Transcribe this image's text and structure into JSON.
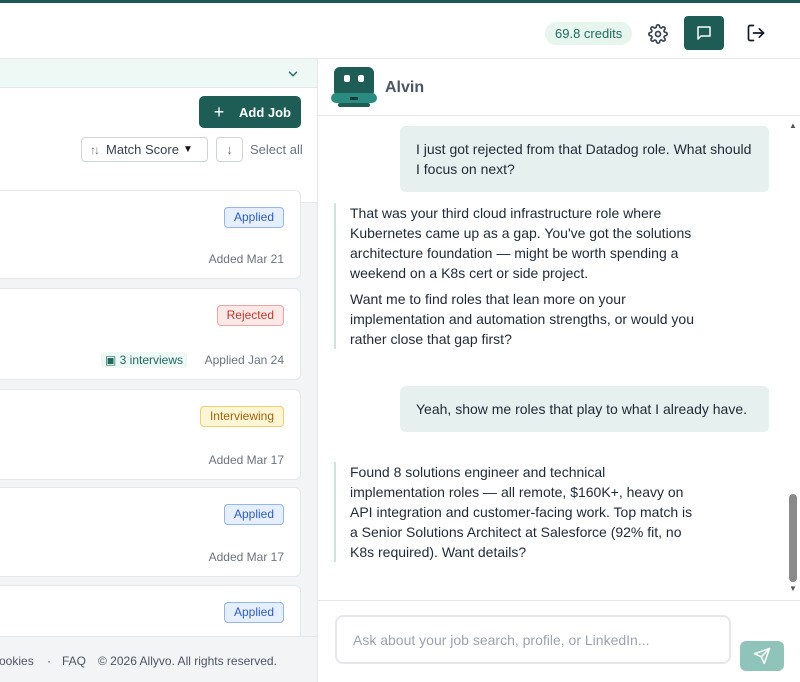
{
  "topbar": {
    "credits": "69.8 credits",
    "settings_icon": "gear-icon",
    "chat_icon": "chat-icon",
    "logout_icon": "logout-icon",
    "accent": "#1d5d56"
  },
  "jobs_panel": {
    "add_job_label": "Add Job",
    "sort_label": "Match Score",
    "select_all_label": "Select all",
    "cards": [
      {
        "status": "Applied",
        "date": "Added Mar 21"
      },
      {
        "status": "Rejected",
        "interviews": "3 interviews",
        "date": "Applied Jan 24"
      },
      {
        "status": "Interviewing",
        "date": "Added Mar 17"
      },
      {
        "status": "Applied",
        "date": "Added Mar 17"
      },
      {
        "status": "Applied"
      }
    ],
    "footer": {
      "cookies": "ookies",
      "sep": "·",
      "faq": "FAQ",
      "copyright": "© 2026 Allyvo. All rights reserved."
    }
  },
  "chat": {
    "assistant_name": "Alvin",
    "messages": [
      {
        "role": "user",
        "text": "I just got rejected from that Datadog role. What should I focus on next?"
      },
      {
        "role": "assistant",
        "paragraphs": [
          "That was your third cloud infrastructure role where Kubernetes came up as a gap. You've got the solutions architecture foundation — might be worth spending a weekend on a K8s cert or side project.",
          "Want me to find roles that lean more on your implementation and automation strengths, or would you rather close that gap first?"
        ]
      },
      {
        "role": "user",
        "text": "Yeah, show me roles that play to what I already have."
      },
      {
        "role": "assistant",
        "paragraphs": [
          "Found 8 solutions engineer and technical implementation roles — all remote, $160K+, heavy on API integration and customer-facing work. Top match is a Senior Solutions Architect at Salesforce (92% fit, no K8s required). Want details?"
        ]
      }
    ],
    "input_placeholder": "Ask about your job search, profile, or LinkedIn...",
    "send_icon": "send-icon"
  }
}
